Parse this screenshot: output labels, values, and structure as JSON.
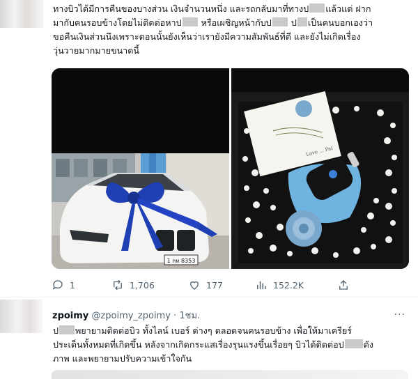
{
  "tweet1": {
    "text": {
      "l1a": "ทางบิวได้มีการคืนของบางส่วน เงินจำนวนหนึ่ง และรถกลับมาที่ทางป",
      "l1b": "แล้วแต่ ฝาก",
      "l2a": "มากับคนรอบข้างโดยไม่ติดต่อหาป",
      "l2b": " หรือเผชิญหน้ากับป",
      "l2c": " ป",
      "l2d": "เป็นคนบอกเองว่า",
      "l3": "ขอคืนเงินส่วนนึงเพราะตอนนั้นยังเห็นว่าเรายังมีความสัมพันธ์ที่ดี และยังไม่เกิดเรื่อง",
      "l4": "วุ่นวายมากมายขนาดนี้"
    },
    "photos": {
      "left_plate": "1 กท 8353",
      "right_card": "Love ... Pai"
    },
    "actions": {
      "replies": "1",
      "retweets": "1,706",
      "likes": "177",
      "views": "152.2K"
    },
    "icons": [
      "reply-icon",
      "retweet-icon",
      "like-icon",
      "views-icon",
      "share-icon"
    ]
  },
  "tweet2": {
    "name": "zpoimy",
    "handle": "@zpoimy_zpoimy",
    "sep": "·",
    "time": "1ชม.",
    "more": "···",
    "text": {
      "l1a": "ป",
      "l1b": "พยายามติดต่อบิว ทั้งไลน์ เบอร์ ต่างๆ ตลอดจนคนรอบข้าง เพื่อให้มาเครียร์",
      "l2a": "ประเด็นทั้งหมดที่เกิดขึ้น หลังจากเกิดกระแสเรื่องรุนแรงขึ้นเรื่อยๆ บิวได้ติดต่อป",
      "l2b": "ดัง",
      "l3": "ภาพ และพยายามปรับความเข้าใจกัน"
    }
  },
  "colors": {
    "text": "#0f1419",
    "muted": "#536471",
    "ribbon": "#1f3fb4"
  }
}
